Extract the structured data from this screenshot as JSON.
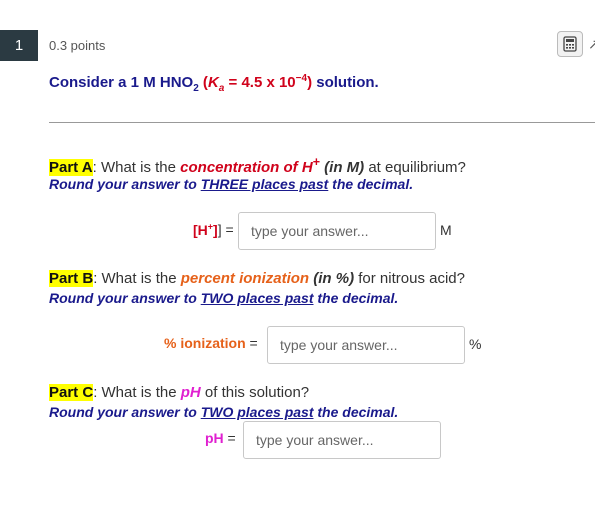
{
  "question": {
    "number": "1",
    "points": "0.3 points",
    "title": {
      "prefix": "Consider a 1 M HNO",
      "sub": "2",
      "paren_open": " (",
      "k": "K",
      "a": "a",
      "ka_eq": " = 4.5 x 10",
      "exp": "−4",
      "paren_close": ")",
      "suffix": " solution."
    }
  },
  "parts": {
    "a": {
      "tag": "Part A",
      "q_pre": ": What is the ",
      "highlight": "concentration of H",
      "highlight_sup": "+",
      "unit_paren": " (in M)",
      "q_post": " at equilibrium?",
      "round_pre": "Round your answer to ",
      "round_u": "THREE places past",
      "round_post": " the decimal.",
      "label_pre": "[H",
      "label_sup": "+",
      "label_post": "] =",
      "placeholder": "type your answer...",
      "unit": "M"
    },
    "b": {
      "tag": "Part B",
      "q_pre": ": What is the ",
      "highlight": "percent ionization",
      "unit_paren": " (in %)",
      "q_post": " for nitrous acid?",
      "round_pre": "Round your answer to ",
      "round_u": "TWO places past",
      "round_post": " the decimal.",
      "label": "% ionization",
      "label_eq": " =",
      "placeholder": "type your answer...",
      "unit": "%"
    },
    "c": {
      "tag": "Part C",
      "q_pre": ": What is the ",
      "highlight": "pH",
      "q_post": " of this solution?",
      "round_pre": "Round your answer to ",
      "round_u": "TWO places past",
      "round_post": " the decimal.",
      "label": "pH",
      "label_eq": " =",
      "placeholder": "type your answer..."
    }
  },
  "icons": {
    "calculator": "calculator-icon",
    "expand": "expand-icon"
  },
  "colors": {
    "question_badge": "#2b3a42",
    "title_blue": "#1a1a8c",
    "red": "#d0021b",
    "orange": "#e6611a",
    "magenta": "#e020d0",
    "highlight": "#ffff00"
  }
}
